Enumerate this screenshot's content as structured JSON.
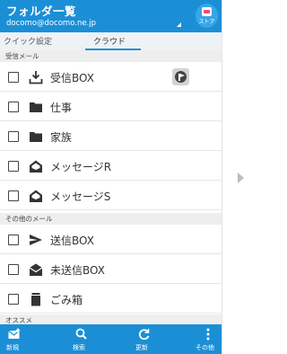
{
  "header": {
    "title": "フォルダ一覧",
    "account": "docomo@docomo.ne.jp",
    "store_label": "ストア",
    "bg_color": "#1b8fd6"
  },
  "tabs": [
    {
      "label": "クイック設定",
      "selected": false
    },
    {
      "label": "クラウド",
      "selected": true
    }
  ],
  "sections": {
    "inbox_section": "受信メール",
    "other_section": "その他のメール",
    "recommend_section": "オススメ"
  },
  "folders": [
    {
      "label": "受信BOX",
      "icon": "inbox-tray-icon",
      "badge": "flag-badge-icon"
    },
    {
      "label": "仕事",
      "icon": "folder-icon"
    },
    {
      "label": "家族",
      "icon": "folder-icon"
    },
    {
      "label": "メッセージR",
      "icon": "open-envelope-icon"
    },
    {
      "label": "メッセージS",
      "icon": "open-envelope-icon"
    }
  ],
  "other_folders": [
    {
      "label": "送信BOX",
      "icon": "send-icon"
    },
    {
      "label": "未送信BOX",
      "icon": "envelope-icon"
    },
    {
      "label": "ごみ箱",
      "icon": "trash-icon"
    }
  ],
  "bottom_bar": [
    {
      "label": "新規",
      "icon": "compose-icon"
    },
    {
      "label": "検索",
      "icon": "search-icon"
    },
    {
      "label": "更新",
      "icon": "refresh-icon"
    },
    {
      "label": "その他",
      "icon": "more-vertical-icon"
    }
  ]
}
